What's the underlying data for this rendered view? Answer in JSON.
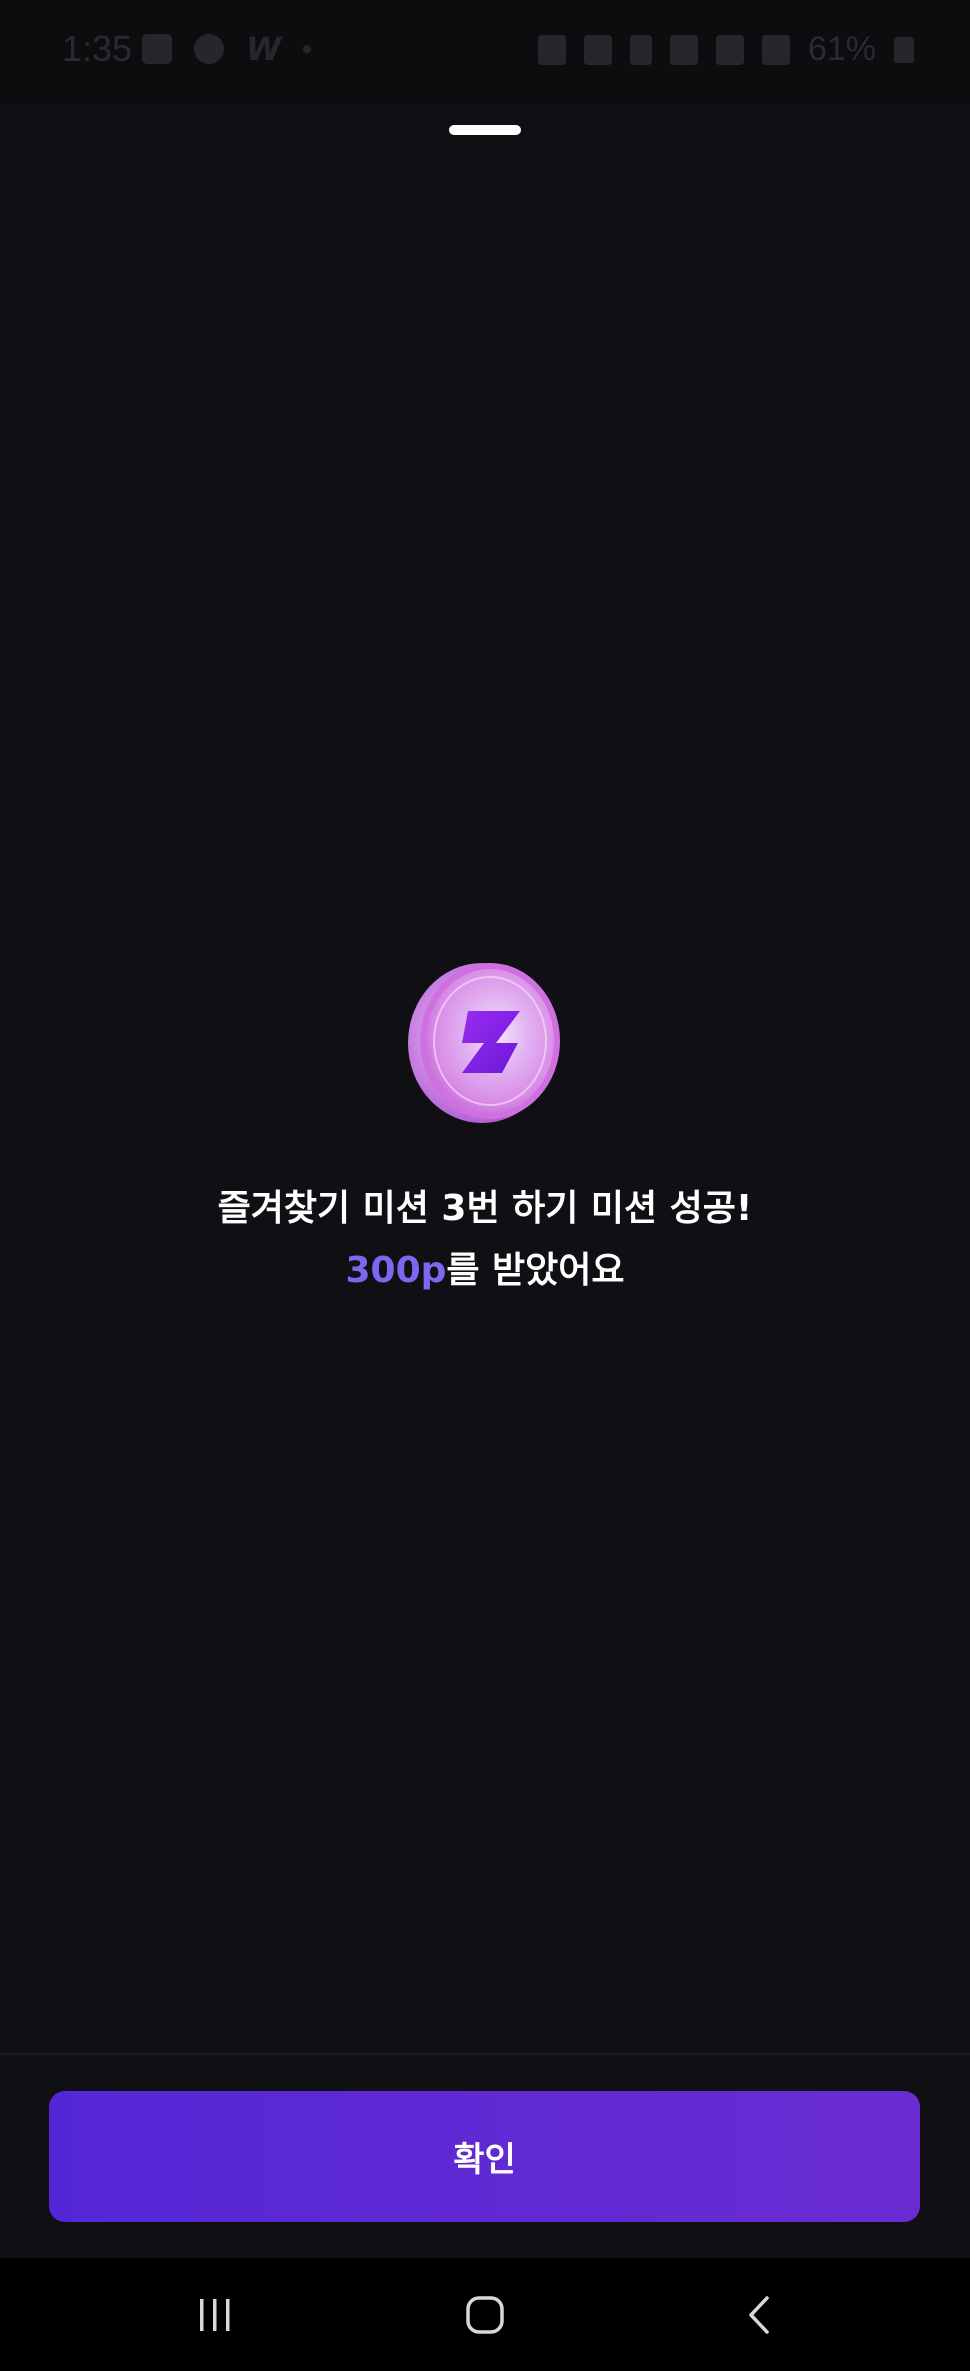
{
  "status_bar": {
    "time": "1:35",
    "battery": "61%"
  },
  "reward": {
    "message": "즐겨찾기 미션 3번 하기 미션 성공!",
    "points": "300p",
    "suffix": "를 받았어요"
  },
  "confirm_button": {
    "label": "확인"
  },
  "icons": {
    "coin": "lightning-coin-icon",
    "recent": "recent-apps-icon",
    "home": "home-icon",
    "back": "back-icon"
  },
  "colors": {
    "background": "#101014",
    "accent": "#7b68f0",
    "button_start": "#5427d6",
    "button_end": "#6a2cd2"
  }
}
